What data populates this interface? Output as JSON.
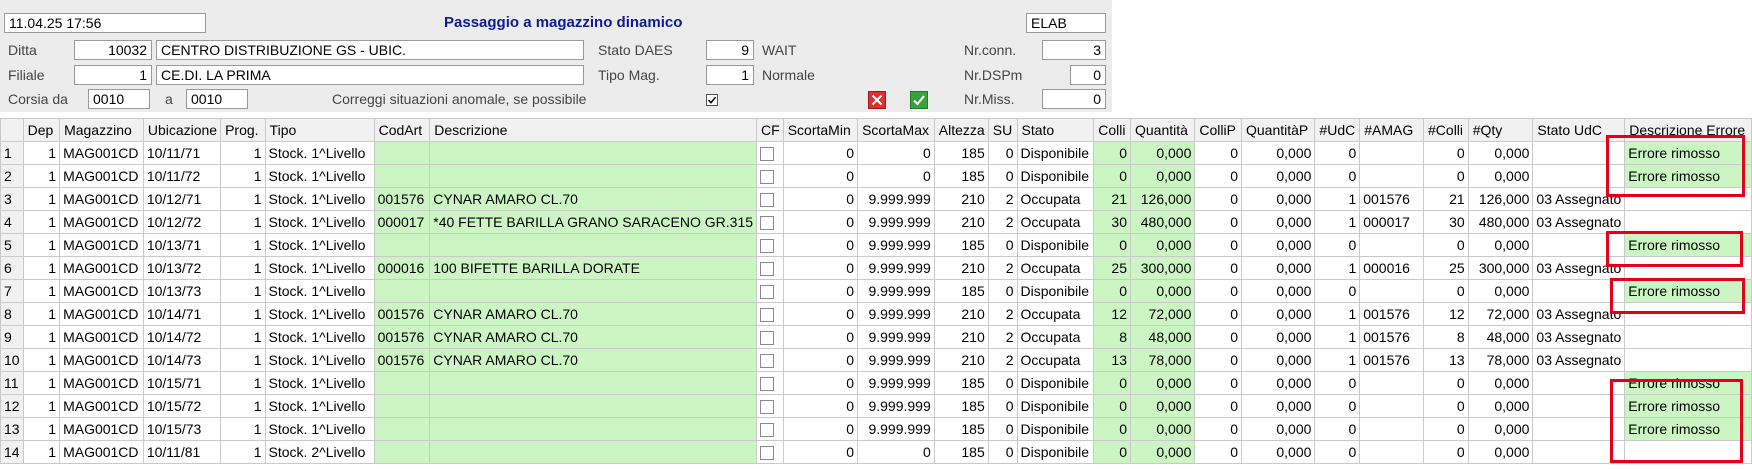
{
  "header": {
    "datetime": "11.04.25 17:56",
    "title": "Passaggio a magazzino dinamico",
    "status_box": "ELAB",
    "ditta_label": "Ditta",
    "ditta_code": "10032",
    "ditta_name": "CENTRO DISTRIBUZIONE GS - UBIC.",
    "filiale_label": "Filiale",
    "filiale_code": "1",
    "filiale_name": "CE.DI. LA PRIMA",
    "corsia_da_label": "Corsia da",
    "corsia_from": "0010",
    "corsia_a_label": "a",
    "corsia_to": "0010",
    "correggi_label": "Correggi situazioni anomale, se possibile",
    "correggi_checked": true,
    "stato_daes_label": "Stato DAES",
    "stato_daes_value": "9",
    "stato_daes_text": "WAIT",
    "tipo_mag_label": "Tipo Mag.",
    "tipo_mag_value": "1",
    "tipo_mag_text": "Normale",
    "nr_conn_label": "Nr.conn.",
    "nr_conn_value": "3",
    "nr_dspm_label": "Nr.DSPm",
    "nr_dspm_value": "0",
    "nr_miss_label": "Nr.Miss.",
    "nr_miss_value": "0",
    "colors": {
      "title": "#0b1d92",
      "cancel": "#e03030",
      "confirm": "#3aa040",
      "highlight": "#ccf5c4",
      "error_outline": "#e2001a"
    }
  },
  "icons": {
    "cancel": "cancel-x-icon",
    "confirm": "confirm-check-icon"
  },
  "grid": {
    "columns": [
      "Dep",
      "Magazzino",
      "Ubicazione",
      "Prog.",
      "Tipo",
      "CodArt",
      "Descrizione",
      "CF",
      "ScortaMin",
      "ScortaMax",
      "Altezza",
      "SU",
      "Stato",
      "Colli",
      "Quantità",
      "ColliP",
      "QuantitàP",
      "#UdC",
      "#AMAG",
      "#Colli",
      "#Qty",
      "Stato UdC",
      "Descrizione Errore"
    ],
    "rows": [
      [
        "1",
        "1",
        "MAG001CD",
        "10/11/71",
        "1",
        "Stock.  1^Livello",
        "",
        "",
        "",
        "0",
        "0",
        "185",
        "0",
        "Disponibile",
        "0",
        "0,000",
        "0",
        "0,000",
        "0",
        "",
        "0",
        "0,000",
        "",
        "Errore rimosso"
      ],
      [
        "2",
        "1",
        "MAG001CD",
        "10/11/72",
        "1",
        "Stock.  1^Livello",
        "",
        "",
        "",
        "0",
        "0",
        "185",
        "0",
        "Disponibile",
        "0",
        "0,000",
        "0",
        "0,000",
        "0",
        "",
        "0",
        "0,000",
        "",
        "Errore rimosso"
      ],
      [
        "3",
        "1",
        "MAG001CD",
        "10/12/71",
        "1",
        "Stock.  1^Livello",
        "001576",
        "CYNAR AMARO CL.70",
        "",
        "0",
        "9.999.999",
        "210",
        "2",
        "Occupata",
        "21",
        "126,000",
        "0",
        "0,000",
        "1",
        "001576",
        "21",
        "126,000",
        "03 Assegnato",
        ""
      ],
      [
        "4",
        "1",
        "MAG001CD",
        "10/12/72",
        "1",
        "Stock.  1^Livello",
        "000017",
        "*40 FETTE BARILLA GRANO SARACENO GR.315",
        "",
        "0",
        "9.999.999",
        "210",
        "2",
        "Occupata",
        "30",
        "480,000",
        "0",
        "0,000",
        "1",
        "000017",
        "30",
        "480,000",
        "03 Assegnato",
        ""
      ],
      [
        "5",
        "1",
        "MAG001CD",
        "10/13/71",
        "1",
        "Stock.  1^Livello",
        "",
        "",
        "",
        "0",
        "9.999.999",
        "185",
        "0",
        "Disponibile",
        "0",
        "0,000",
        "0",
        "0,000",
        "0",
        "",
        "0",
        "0,000",
        "",
        "Errore rimosso"
      ],
      [
        "6",
        "1",
        "MAG001CD",
        "10/13/72",
        "1",
        "Stock.  1^Livello",
        "000016",
        "100 BIFETTE BARILLA DORATE",
        "",
        "0",
        "9.999.999",
        "210",
        "2",
        "Occupata",
        "25",
        "300,000",
        "0",
        "0,000",
        "1",
        "000016",
        "25",
        "300,000",
        "03 Assegnato",
        ""
      ],
      [
        "7",
        "1",
        "MAG001CD",
        "10/13/73",
        "1",
        "Stock.  1^Livello",
        "",
        "",
        "",
        "0",
        "9.999.999",
        "185",
        "0",
        "Disponibile",
        "0",
        "0,000",
        "0",
        "0,000",
        "0",
        "",
        "0",
        "0,000",
        "",
        "Errore rimosso"
      ],
      [
        "8",
        "1",
        "MAG001CD",
        "10/14/71",
        "1",
        "Stock.  1^Livello",
        "001576",
        "CYNAR AMARO CL.70",
        "",
        "0",
        "9.999.999",
        "210",
        "2",
        "Occupata",
        "12",
        "72,000",
        "0",
        "0,000",
        "1",
        "001576",
        "12",
        "72,000",
        "03 Assegnato",
        ""
      ],
      [
        "9",
        "1",
        "MAG001CD",
        "10/14/72",
        "1",
        "Stock.  1^Livello",
        "001576",
        "CYNAR AMARO CL.70",
        "",
        "0",
        "9.999.999",
        "210",
        "2",
        "Occupata",
        "8",
        "48,000",
        "0",
        "0,000",
        "1",
        "001576",
        "8",
        "48,000",
        "03 Assegnato",
        ""
      ],
      [
        "10",
        "1",
        "MAG001CD",
        "10/14/73",
        "1",
        "Stock.  1^Livello",
        "001576",
        "CYNAR AMARO CL.70",
        "",
        "0",
        "9.999.999",
        "210",
        "2",
        "Occupata",
        "13",
        "78,000",
        "0",
        "0,000",
        "1",
        "001576",
        "13",
        "78,000",
        "03 Assegnato",
        ""
      ],
      [
        "11",
        "1",
        "MAG001CD",
        "10/15/71",
        "1",
        "Stock.  1^Livello",
        "",
        "",
        "",
        "0",
        "9.999.999",
        "185",
        "0",
        "Disponibile",
        "0",
        "0,000",
        "0",
        "0,000",
        "0",
        "",
        "0",
        "0,000",
        "",
        "Errore rimosso"
      ],
      [
        "12",
        "1",
        "MAG001CD",
        "10/15/72",
        "1",
        "Stock.  1^Livello",
        "",
        "",
        "",
        "0",
        "9.999.999",
        "185",
        "0",
        "Disponibile",
        "0",
        "0,000",
        "0",
        "0,000",
        "0",
        "",
        "0",
        "0,000",
        "",
        "Errore rimosso"
      ],
      [
        "13",
        "1",
        "MAG001CD",
        "10/15/73",
        "1",
        "Stock.  1^Livello",
        "",
        "",
        "",
        "0",
        "9.999.999",
        "185",
        "0",
        "Disponibile",
        "0",
        "0,000",
        "0",
        "0,000",
        "0",
        "",
        "0",
        "0,000",
        "",
        "Errore rimosso"
      ],
      [
        "14",
        "1",
        "MAG001CD",
        "10/11/81",
        "1",
        "Stock.  2^Livello",
        "",
        "",
        "",
        "0",
        "0",
        "185",
        "0",
        "Disponibile",
        "0",
        "0,000",
        "0",
        "0,000",
        "0",
        "",
        "0",
        "0,000",
        "",
        ""
      ]
    ]
  }
}
